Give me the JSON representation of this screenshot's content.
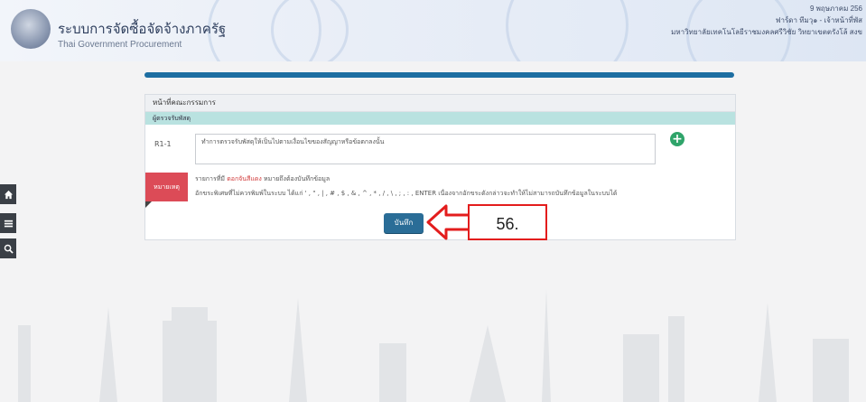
{
  "header": {
    "title_th": "ระบบการจัดซื้อจัดจ้างภาครัฐ",
    "title_en": "Thai Government Procurement",
    "right_line1": "9 พฤษภาคม 256",
    "right_line2": "ฟาร์ดา ทีมวุ๑ - เจ้าหน้าที่พัส",
    "right_line3": "มหาวิทยาลัยเทคโนโลยีราชมงคลศรีวิชัย วิทยาเขตตรังโล้ สงข"
  },
  "panel": {
    "heading": "หน้าที่คณะกรรมการ",
    "subheading": "ผู้ตรวจรับพัสดุ",
    "row_label": "R1-1",
    "textarea_value": "ทำการตรวจรับพัสดุให้เป็นไปตามเงื่อนไขของสัญญาหรือข้อตกลงนั้น",
    "note_label": "หมายเหตุ",
    "note_line1_prefix": "รายการที่มี",
    "note_line1_red": "ดอกจันสีแดง",
    "note_line1_suffix": "หมายถึงต้องบันทึกข้อมูล",
    "note_line2": "อักขระพิเศษที่ไม่ควรพิมพ์ในระบบ ได้แก่ ' , \" , | , # , $ , & , ^ , * , / , \\ , ; , : , ENTER เนื่องจากอักขระดังกล่าวจะทำให้ไม่สามารถบันทึกข้อมูลในระบบได้",
    "save_label": "บันทึก"
  },
  "annotation": {
    "step_label": "56."
  },
  "sidebar": {
    "icons": [
      "home-icon",
      "menu-icon",
      "search-icon"
    ]
  },
  "colors": {
    "accent_blue": "#1d6ea2",
    "save_button": "#2a6d97",
    "note_red": "#dc4b57",
    "subheader_teal": "#b9e2e0",
    "plus_green": "#2fa46a",
    "annotation_red": "#e31d1d"
  }
}
